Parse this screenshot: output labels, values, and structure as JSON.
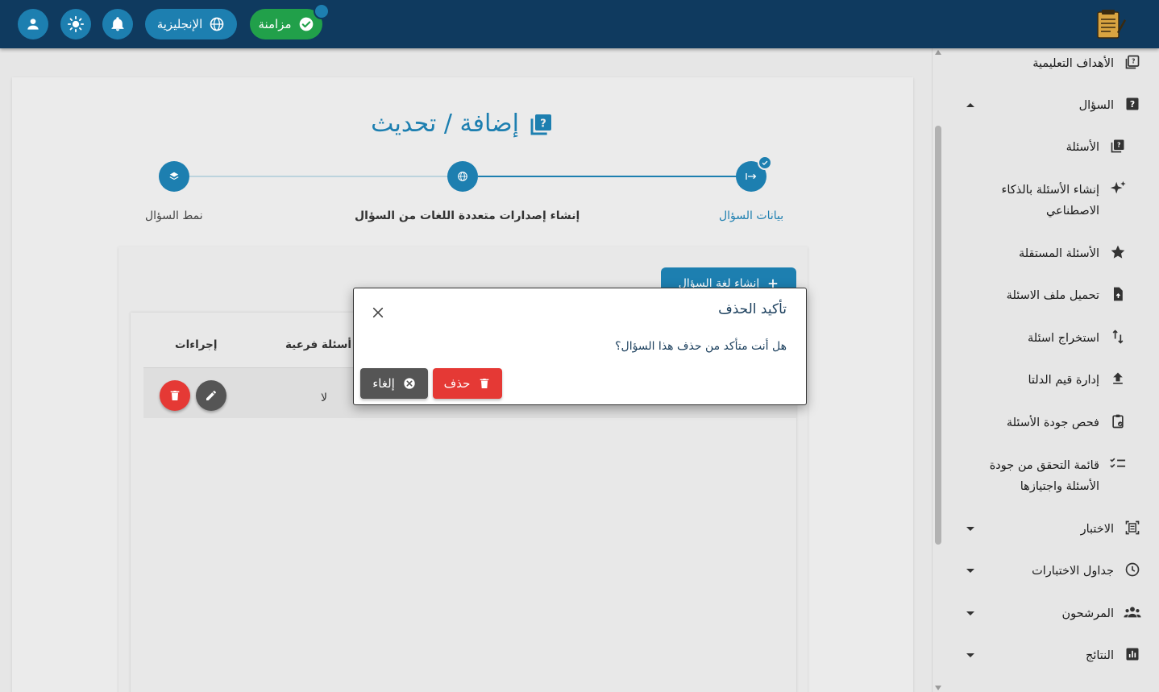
{
  "header": {
    "sync_label": "مزامنة",
    "language_label": "الإنجليزية"
  },
  "sidebar": {
    "items": [
      {
        "label": "الأهداف التعليمية",
        "icon": "objectives-icon"
      },
      {
        "label": "السؤال",
        "icon": "question-icon"
      },
      {
        "label": "الأسئلة",
        "icon": "questions-icon"
      },
      {
        "label": "إنشاء الأسئلة بالذكاء الاصطناعي",
        "icon": "sparkle-icon"
      },
      {
        "label": "الأسئلة المستقلة",
        "icon": "star-icon"
      },
      {
        "label": "تحميل ملف الاسئلة",
        "icon": "file-upload-icon"
      },
      {
        "label": "استخراج اسئلة",
        "icon": "swap-vert-icon"
      },
      {
        "label": "إدارة قيم الدلتا",
        "icon": "upload-icon"
      },
      {
        "label": "فحص جودة الأسئلة",
        "icon": "clipboard-check-icon"
      },
      {
        "label": "قائمة التحقق من جودة الأسئلة واجتيازها",
        "icon": "checklist-icon"
      },
      {
        "label": "الاختبار",
        "icon": "exam-icon"
      },
      {
        "label": "جداول الاختبارات",
        "icon": "clock-icon"
      },
      {
        "label": "المرشحون",
        "icon": "people-icon"
      },
      {
        "label": "النتائج",
        "icon": "bar-chart-icon"
      }
    ]
  },
  "main": {
    "title": "إضافة / تحديث",
    "steps": [
      {
        "label": "بيانات السؤال"
      },
      {
        "label": "إنشاء إصدارات متعددة اللغات من السؤال"
      },
      {
        "label": "نمط السؤال"
      }
    ],
    "create_lang_button": "إنشاء لغة السؤال",
    "table": {
      "headers": {
        "actions": "إجراءات",
        "sub_questions": "أسئلة فرعية"
      },
      "rows": [
        {
          "sub_questions": "لا"
        }
      ]
    }
  },
  "dialog": {
    "title": "تأكيد الحذف",
    "message": "هل أنت متأكد من حذف هذا السؤال؟",
    "delete_label": "حذف",
    "cancel_label": "إلغاء"
  },
  "colors": {
    "topbar": "#0f3a5f",
    "accent": "#1d7fb0",
    "sync": "#21a04a",
    "danger": "#e53935",
    "cancel": "#555555"
  }
}
